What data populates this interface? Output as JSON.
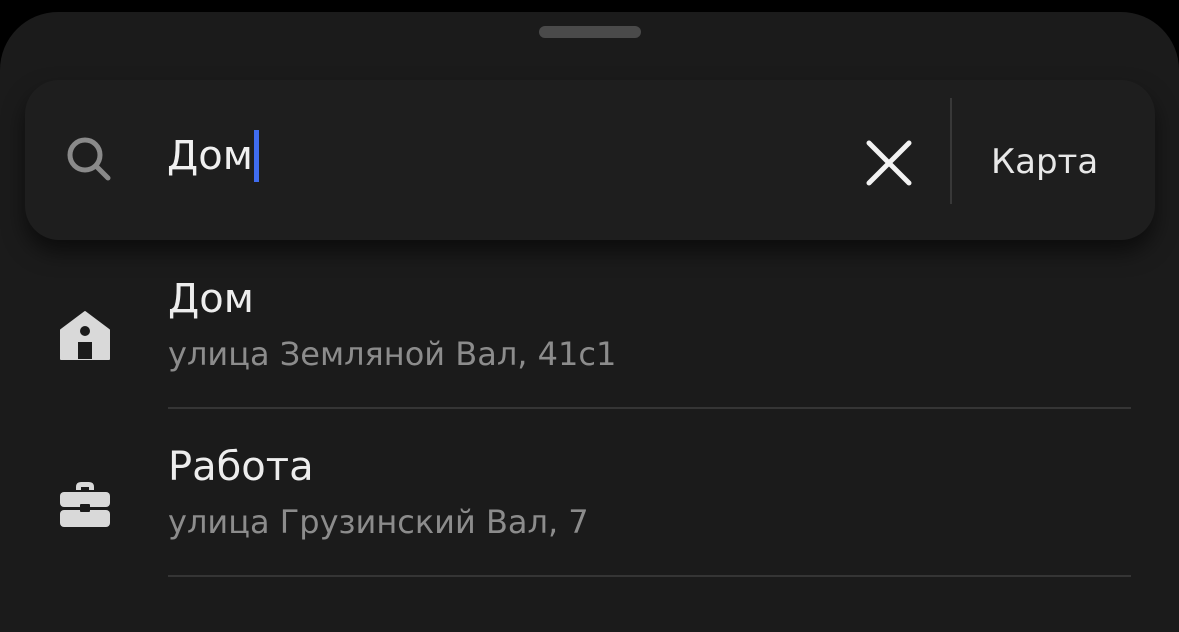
{
  "search": {
    "query": "Дом",
    "map_button_label": "Карта"
  },
  "icons": {
    "search": "search-icon",
    "clear": "close-icon",
    "home": "home-icon",
    "work": "briefcase-icon"
  },
  "colors": {
    "background": "#1b1b1b",
    "caret": "#3f6cf0",
    "primary_text": "#ededed",
    "secondary_text": "#8c8c8c"
  },
  "suggestions": [
    {
      "title": "Дом",
      "address": "улица Земляной Вал, 41с1",
      "icon": "home-icon"
    },
    {
      "title": "Работа",
      "address": "улица Грузинский Вал, 7",
      "icon": "briefcase-icon"
    }
  ]
}
